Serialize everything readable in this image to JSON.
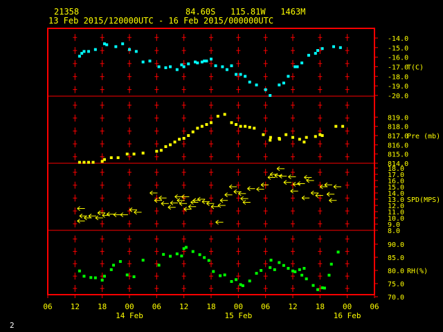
{
  "header": {
    "station_id": "21358",
    "location": "84.60S   115.81W   1463M",
    "time_range": "13 Feb 2015/120000UTC - 16 Feb 2015/000000UTC"
  },
  "footer": {
    "page_number": "2"
  },
  "colors": {
    "frame": "#ff0000",
    "grid": "#ff0000",
    "temperature": "#00ffff",
    "pressure": "#ffff00",
    "wind": "#ffff00",
    "humidity": "#00ff00",
    "text": "#ffff00"
  },
  "chart_data": {
    "type": "scatter",
    "xaxis": {
      "unit": "hours since 13 Feb 00UTC",
      "range": [
        6,
        78
      ],
      "ticks": [
        {
          "v": 6,
          "label": "06"
        },
        {
          "v": 12,
          "label": "12"
        },
        {
          "v": 18,
          "label": "18"
        },
        {
          "v": 24,
          "label": "00"
        },
        {
          "v": 30,
          "label": "06"
        },
        {
          "v": 36,
          "label": "12"
        },
        {
          "v": 42,
          "label": "18"
        },
        {
          "v": 48,
          "label": "00"
        },
        {
          "v": 54,
          "label": "06"
        },
        {
          "v": 60,
          "label": "12"
        },
        {
          "v": 66,
          "label": "18"
        },
        {
          "v": 72,
          "label": "00"
        },
        {
          "v": 78,
          "label": "06"
        }
      ],
      "date_labels": [
        {
          "v": 24,
          "label": "14 Feb"
        },
        {
          "v": 48,
          "label": "15 Feb"
        },
        {
          "v": 72,
          "label": "16 Feb"
        }
      ]
    },
    "panels": [
      {
        "name": "temperature",
        "label": "T(C)",
        "ylim": [
          -20.0,
          -14.0
        ],
        "ticks": [
          "-14.0",
          "-15.0",
          "-16.0",
          "-17.0",
          "-18.0",
          "-19.0",
          "-20.0"
        ],
        "tick_values": [
          -14,
          -15,
          -16,
          -17,
          -18,
          -19,
          -20
        ],
        "marker": "square",
        "points": [
          [
            13,
            -15.9
          ],
          [
            13.5,
            -15.6
          ],
          [
            14,
            -15.4
          ],
          [
            15,
            -15.4
          ],
          [
            16.5,
            -15.2
          ],
          [
            18.5,
            -14.6
          ],
          [
            19,
            -14.7
          ],
          [
            21,
            -14.9
          ],
          [
            22.5,
            -14.6
          ],
          [
            24,
            -15.2
          ],
          [
            25.5,
            -15.4
          ],
          [
            27,
            -16.5
          ],
          [
            28.5,
            -16.4
          ],
          [
            30.5,
            -17.0
          ],
          [
            32,
            -17.1
          ],
          [
            33,
            -17.0
          ],
          [
            34.5,
            -17.3
          ],
          [
            35.5,
            -16.8
          ],
          [
            36,
            -17.0
          ],
          [
            37,
            -16.7
          ],
          [
            38.5,
            -16.5
          ],
          [
            39,
            -16.6
          ],
          [
            40,
            -16.5
          ],
          [
            40.5,
            -16.4
          ],
          [
            41,
            -16.4
          ],
          [
            42,
            -16.2
          ],
          [
            43,
            -16.9
          ],
          [
            44.5,
            -17.0
          ],
          [
            45.5,
            -17.3
          ],
          [
            46.5,
            -16.9
          ],
          [
            47.5,
            -17.8
          ],
          [
            48.5,
            -17.8
          ],
          [
            49.5,
            -18.0
          ],
          [
            50.5,
            -18.6
          ],
          [
            52,
            -18.9
          ],
          [
            54,
            -19.4
          ],
          [
            55,
            -20.0
          ],
          [
            57,
            -18.9
          ],
          [
            58,
            -18.7
          ],
          [
            59,
            -18.0
          ],
          [
            60.5,
            -17.0
          ],
          [
            61,
            -17.0
          ],
          [
            62,
            -16.6
          ],
          [
            63.5,
            -15.8
          ],
          [
            65,
            -15.6
          ],
          [
            65.5,
            -15.3
          ],
          [
            66.5,
            -15.1
          ],
          [
            69,
            -14.9
          ],
          [
            70.5,
            -15.0
          ]
        ]
      },
      {
        "name": "pressure",
        "label": "Pre (mb)",
        "ylim": [
          814.0,
          820.0
        ],
        "ticks": [
          "819.0",
          "818.0",
          "817.0",
          "816.0",
          "815.0",
          "814.0"
        ],
        "tick_values": [
          819,
          818,
          817,
          816,
          815,
          814
        ],
        "marker": "square",
        "points": [
          [
            13,
            814.1
          ],
          [
            14,
            814.1
          ],
          [
            15,
            814.1
          ],
          [
            16,
            814.1
          ],
          [
            18,
            814.2
          ],
          [
            18.5,
            814.4
          ],
          [
            20,
            814.6
          ],
          [
            21.5,
            814.6
          ],
          [
            23.5,
            815.0
          ],
          [
            25,
            815.0
          ],
          [
            27,
            815.1
          ],
          [
            30,
            815.3
          ],
          [
            31,
            815.4
          ],
          [
            32,
            815.8
          ],
          [
            33,
            816.0
          ],
          [
            34,
            816.3
          ],
          [
            35,
            816.6
          ],
          [
            36,
            816.7
          ],
          [
            37,
            817.0
          ],
          [
            38,
            817.4
          ],
          [
            39,
            817.8
          ],
          [
            40,
            818.0
          ],
          [
            41,
            818.2
          ],
          [
            42,
            818.4
          ],
          [
            43.5,
            819.1
          ],
          [
            45,
            819.3
          ],
          [
            46.5,
            818.4
          ],
          [
            47.5,
            818.2
          ],
          [
            48.5,
            818.0
          ],
          [
            49.5,
            818.0
          ],
          [
            50.5,
            817.9
          ],
          [
            51.5,
            817.8
          ],
          [
            53.5,
            817.1
          ],
          [
            55,
            816.5
          ],
          [
            55.1,
            816.8
          ],
          [
            57,
            816.7
          ],
          [
            57.1,
            816.6
          ],
          [
            58.5,
            817.1
          ],
          [
            60,
            816.8
          ],
          [
            61.5,
            816.6
          ],
          [
            62.5,
            816.3
          ],
          [
            63,
            816.8
          ],
          [
            65,
            816.9
          ],
          [
            66,
            817.1
          ],
          [
            66.5,
            817.0
          ],
          [
            69.5,
            818.0
          ],
          [
            71,
            818.0
          ]
        ]
      },
      {
        "name": "wind",
        "label": "SPD(MPS)",
        "ylim": [
          8.0,
          18.0
        ],
        "ticks": [
          "18.0",
          "17.0",
          "16.0",
          "15.0",
          "14.0",
          "13.0",
          "12.0",
          "11.0",
          "10.0",
          "9.0",
          "8.0"
        ],
        "tick_values": [
          18,
          17,
          16,
          15,
          14,
          13,
          12,
          11,
          10,
          9,
          8
        ],
        "marker": "arrow",
        "points": [
          [
            12.5,
            11.5
          ],
          [
            12.5,
            9.5
          ],
          [
            13,
            10.3
          ],
          [
            14,
            10.0
          ],
          [
            15,
            10.3
          ],
          [
            16.5,
            10.0
          ],
          [
            17,
            10.8
          ],
          [
            18,
            10.4
          ],
          [
            19,
            10.6
          ],
          [
            20.5,
            10.5
          ],
          [
            22,
            10.5
          ],
          [
            24,
            11.3
          ],
          [
            25,
            10.9
          ],
          [
            28.5,
            14.0
          ],
          [
            29.5,
            12.8
          ],
          [
            30.5,
            13.2
          ],
          [
            31,
            12.3
          ],
          [
            32.5,
            11.7
          ],
          [
            33,
            12.4
          ],
          [
            34,
            13.4
          ],
          [
            34.5,
            12.8
          ],
          [
            35,
            12.3
          ],
          [
            35.5,
            13.4
          ],
          [
            36,
            11.4
          ],
          [
            37,
            11.8
          ],
          [
            37.5,
            12.5
          ],
          [
            38,
            12.8
          ],
          [
            39,
            13.0
          ],
          [
            40,
            12.6
          ],
          [
            41,
            12.3
          ],
          [
            42,
            11.8
          ],
          [
            43,
            9.3
          ],
          [
            43.5,
            12.0
          ],
          [
            44,
            12.8
          ],
          [
            45,
            13.7
          ],
          [
            46,
            15.0
          ],
          [
            47,
            14.2
          ],
          [
            48,
            13.9
          ],
          [
            48.5,
            13.1
          ],
          [
            49,
            12.5
          ],
          [
            50,
            14.7
          ],
          [
            52,
            14.6
          ],
          [
            53,
            15.3
          ],
          [
            54.5,
            16.5
          ],
          [
            55,
            17.0
          ],
          [
            56,
            16.8
          ],
          [
            56.5,
            17.9
          ],
          [
            57,
            16.7
          ],
          [
            58,
            15.7
          ],
          [
            59,
            16.6
          ],
          [
            59.5,
            14.3
          ],
          [
            60,
            15.4
          ],
          [
            61,
            15.5
          ],
          [
            62,
            13.2
          ],
          [
            62.5,
            16.5
          ],
          [
            63,
            16.0
          ],
          [
            64,
            14.0
          ],
          [
            65,
            13.6
          ],
          [
            66,
            15.0
          ],
          [
            67,
            15.3
          ],
          [
            67.5,
            13.8
          ],
          [
            68,
            12.8
          ],
          [
            69,
            15.0
          ]
        ]
      },
      {
        "name": "humidity",
        "label": "RH(%)",
        "ylim": [
          70.0,
          90.0
        ],
        "ticks": [
          "90.0",
          "85.0",
          "80.0",
          "75.0",
          "70.0"
        ],
        "tick_values": [
          90,
          85,
          80,
          75,
          70
        ],
        "marker": "square",
        "points": [
          [
            13,
            79.8
          ],
          [
            14,
            77.8
          ],
          [
            15.5,
            77.3
          ],
          [
            16.5,
            77.2
          ],
          [
            18,
            76.3
          ],
          [
            18.5,
            77.8
          ],
          [
            20,
            80.3
          ],
          [
            20.5,
            82.0
          ],
          [
            22,
            83.4
          ],
          [
            23.5,
            78.3
          ],
          [
            25,
            77.6
          ],
          [
            27,
            83.9
          ],
          [
            30.5,
            82.0
          ],
          [
            31.5,
            86.1
          ],
          [
            33,
            85.4
          ],
          [
            34.5,
            86.3
          ],
          [
            35.5,
            85.5
          ],
          [
            36,
            88.3
          ],
          [
            36.5,
            88.8
          ],
          [
            38,
            87.2
          ],
          [
            39.5,
            86.0
          ],
          [
            40.5,
            84.9
          ],
          [
            41.5,
            83.8
          ],
          [
            42.5,
            79.6
          ],
          [
            44,
            78.0
          ],
          [
            45,
            78.3
          ],
          [
            46.5,
            75.8
          ],
          [
            47.5,
            76.5
          ],
          [
            48.5,
            74.6
          ],
          [
            49,
            74.2
          ],
          [
            50.5,
            76.0
          ],
          [
            52,
            78.9
          ],
          [
            53,
            80.0
          ],
          [
            55,
            81.1
          ],
          [
            55.2,
            83.9
          ],
          [
            56,
            80.3
          ],
          [
            57,
            83.0
          ],
          [
            58,
            81.9
          ],
          [
            59,
            80.8
          ],
          [
            60,
            79.8
          ],
          [
            60.5,
            79.5
          ],
          [
            61.5,
            80.3
          ],
          [
            62,
            78.2
          ],
          [
            62.5,
            80.8
          ],
          [
            63,
            76.8
          ],
          [
            64.5,
            74.3
          ],
          [
            65.5,
            72.7
          ],
          [
            66.5,
            73.4
          ],
          [
            67,
            73.3
          ],
          [
            68,
            78.2
          ],
          [
            68.5,
            82.4
          ],
          [
            70,
            87.0
          ]
        ]
      }
    ]
  }
}
